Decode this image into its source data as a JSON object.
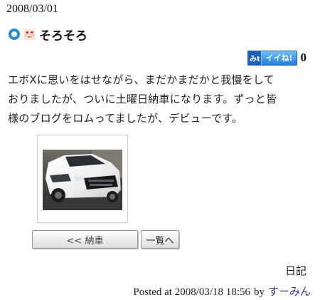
{
  "entry": {
    "date": "2008/03/01",
    "title_icon": "blue-ring-icon",
    "emoji_icon": "love-face-icon",
    "title": "そろそろ",
    "iine": {
      "mark": "みt",
      "label": "イイね!",
      "count": "0",
      "color": "#2a8de0"
    },
    "body_lines": [
      "エボXに思いをはせながら、まだかまだかと我慢をして",
      "おりましたが、ついに土曜日納車になります。ずっと皆",
      "様のブログをロムってましたが、デビューです。"
    ],
    "photo": {
      "subject": "white-car-photo"
    }
  },
  "navigation": {
    "prev_label": "<< 納車",
    "list_label": "一覧へ"
  },
  "meta": {
    "category": "日記",
    "posted_at": "Posted at 2008/03/18 18:56",
    "by": "by",
    "author": "すーみん",
    "author_color": "#3333aa"
  }
}
